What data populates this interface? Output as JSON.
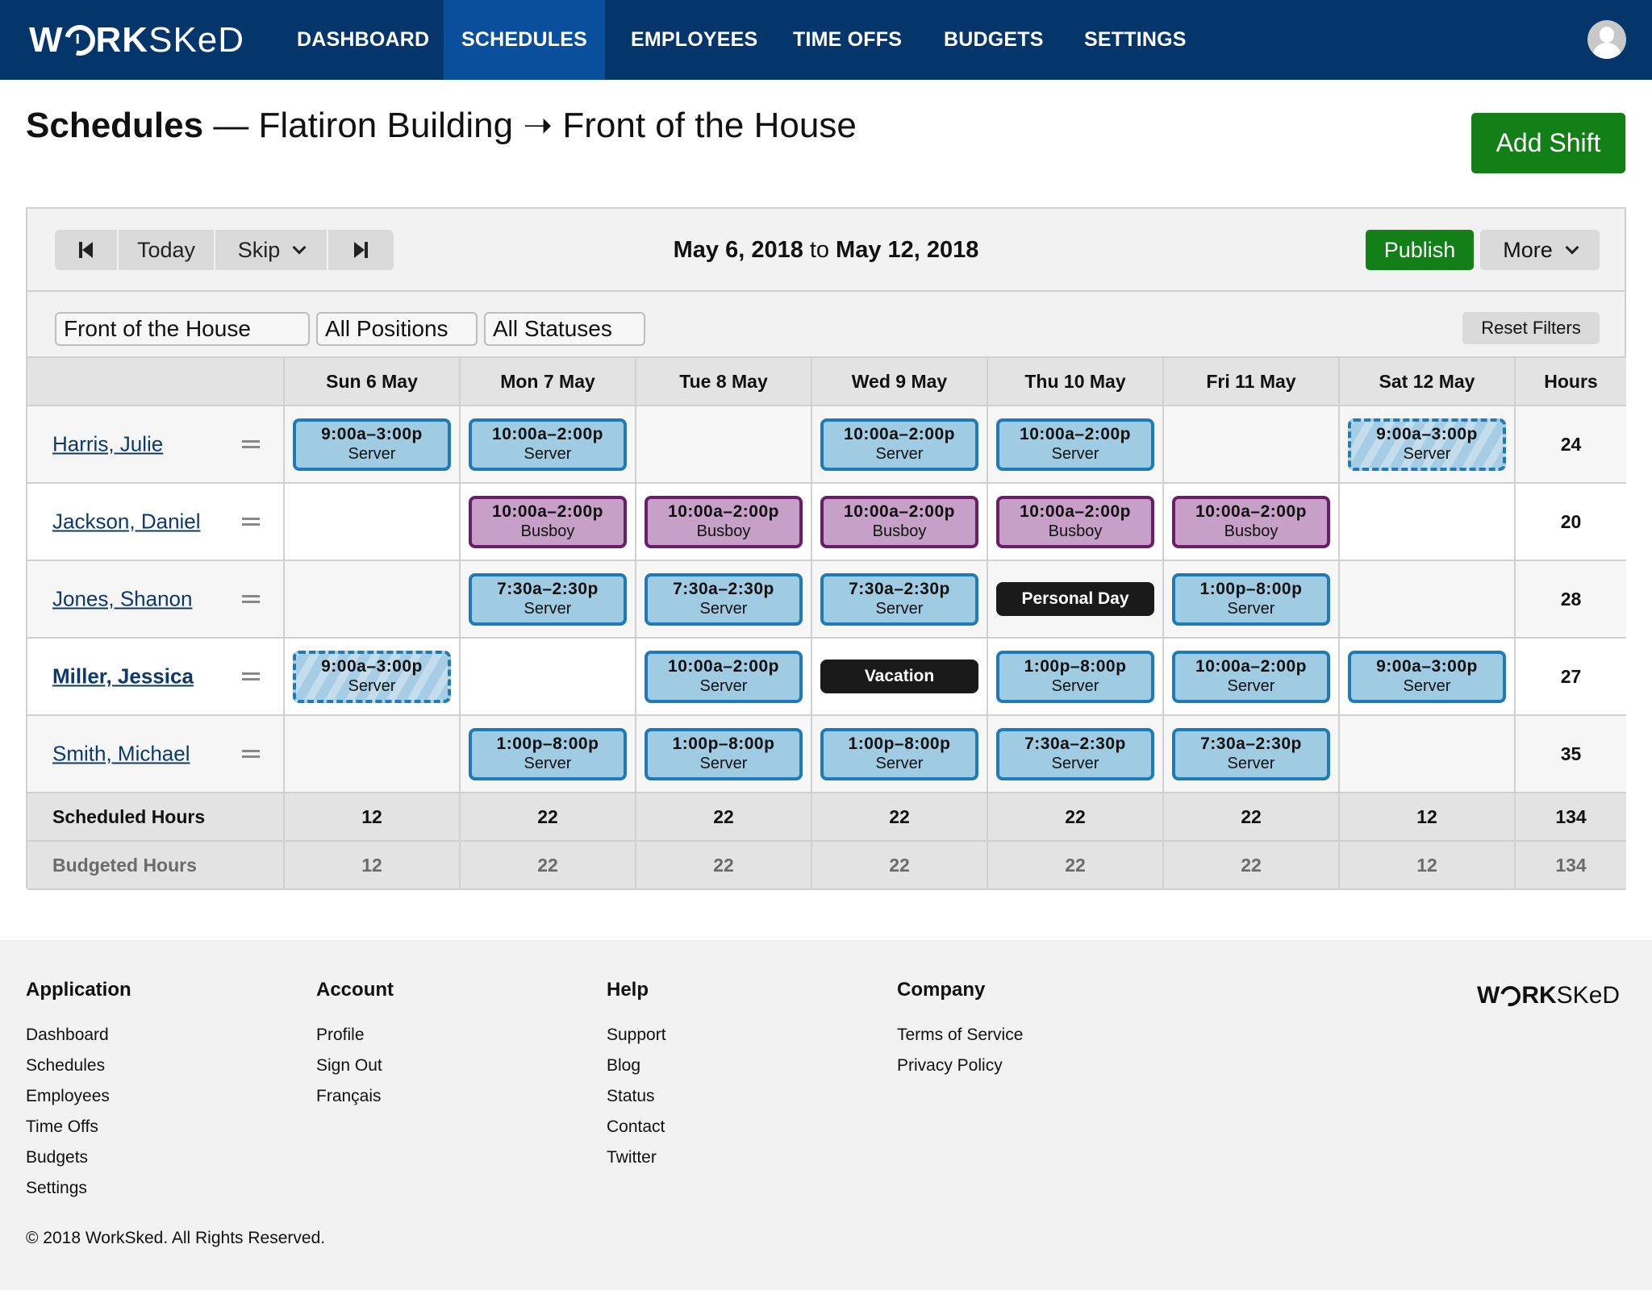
{
  "brand": {
    "logo_bold": "W",
    "logo_bold2": "RK",
    "logo_light": "SKeD",
    "name": "WorkSked"
  },
  "nav": {
    "items": [
      {
        "label": "DASHBOARD",
        "active": false
      },
      {
        "label": "SCHEDULES",
        "active": true
      },
      {
        "label": "EMPLOYEES",
        "active": false
      },
      {
        "label": "TIME OFFS",
        "active": false
      },
      {
        "label": "BUDGETS",
        "active": false
      },
      {
        "label": "SETTINGS",
        "active": false
      }
    ],
    "avatar_icon": "user-avatar-icon"
  },
  "header": {
    "title": "Schedules",
    "separator": " — ",
    "location": "Flatiron Building",
    "arrow": " ➝ ",
    "department": "Front of the House",
    "add_shift_label": "Add Shift"
  },
  "toolbar": {
    "prev_icon": "skip-previous-icon",
    "today_label": "Today",
    "skip_label": "Skip",
    "next_icon": "skip-next-icon",
    "date_start": "May 6, 2018",
    "date_to": "to",
    "date_end": "May 12, 2018",
    "publish_label": "Publish",
    "more_label": "More"
  },
  "filters": {
    "department": "Front of the House",
    "positions": "All Positions",
    "statuses": "All Statuses",
    "reset_label": "Reset Filters"
  },
  "schedule": {
    "days": [
      "Sun 6 May",
      "Mon 7 May",
      "Tue 8 May",
      "Wed 9 May",
      "Thu 10 May",
      "Fri 11 May",
      "Sat 12 May"
    ],
    "hours_header": "Hours",
    "employees": [
      {
        "name": "Harris, Julie",
        "bold": false,
        "hours": "24",
        "cells": [
          {
            "type": "shift",
            "time": "9:00a–3:00p",
            "role": "Server",
            "position": "server",
            "published": true
          },
          {
            "type": "shift",
            "time": "10:00a–2:00p",
            "role": "Server",
            "position": "server",
            "published": true
          },
          null,
          {
            "type": "shift",
            "time": "10:00a–2:00p",
            "role": "Server",
            "position": "server",
            "published": true
          },
          {
            "type": "shift",
            "time": "10:00a–2:00p",
            "role": "Server",
            "position": "server",
            "published": true
          },
          null,
          {
            "type": "shift",
            "time": "9:00a–3:00p",
            "role": "Server",
            "position": "server",
            "published": false
          }
        ]
      },
      {
        "name": "Jackson, Daniel",
        "bold": false,
        "hours": "20",
        "cells": [
          null,
          {
            "type": "shift",
            "time": "10:00a–2:00p",
            "role": "Busboy",
            "position": "busboy",
            "published": true
          },
          {
            "type": "shift",
            "time": "10:00a–2:00p",
            "role": "Busboy",
            "position": "busboy",
            "published": true
          },
          {
            "type": "shift",
            "time": "10:00a–2:00p",
            "role": "Busboy",
            "position": "busboy",
            "published": true
          },
          {
            "type": "shift",
            "time": "10:00a–2:00p",
            "role": "Busboy",
            "position": "busboy",
            "published": true
          },
          {
            "type": "shift",
            "time": "10:00a–2:00p",
            "role": "Busboy",
            "position": "busboy",
            "published": true
          },
          null
        ]
      },
      {
        "name": "Jones, Shanon",
        "bold": false,
        "hours": "28",
        "cells": [
          null,
          {
            "type": "shift",
            "time": "7:30a–2:30p",
            "role": "Server",
            "position": "server",
            "published": true
          },
          {
            "type": "shift",
            "time": "7:30a–2:30p",
            "role": "Server",
            "position": "server",
            "published": true
          },
          {
            "type": "shift",
            "time": "7:30a–2:30p",
            "role": "Server",
            "position": "server",
            "published": true
          },
          {
            "type": "timeoff",
            "label": "Personal Day"
          },
          {
            "type": "shift",
            "time": "1:00p–8:00p",
            "role": "Server",
            "position": "server",
            "published": true
          },
          null
        ]
      },
      {
        "name": "Miller, Jessica",
        "bold": true,
        "hours": "27",
        "cells": [
          {
            "type": "shift",
            "time": "9:00a–3:00p",
            "role": "Server",
            "position": "server",
            "published": false
          },
          null,
          {
            "type": "shift",
            "time": "10:00a–2:00p",
            "role": "Server",
            "position": "server",
            "published": true
          },
          {
            "type": "timeoff",
            "label": "Vacation"
          },
          {
            "type": "shift",
            "time": "1:00p–8:00p",
            "role": "Server",
            "position": "server",
            "published": true
          },
          {
            "type": "shift",
            "time": "10:00a–2:00p",
            "role": "Server",
            "position": "server",
            "published": true
          },
          {
            "type": "shift",
            "time": "9:00a–3:00p",
            "role": "Server",
            "position": "server",
            "published": true
          }
        ]
      },
      {
        "name": "Smith, Michael",
        "bold": false,
        "hours": "35",
        "cells": [
          null,
          {
            "type": "shift",
            "time": "1:00p–8:00p",
            "role": "Server",
            "position": "server",
            "published": true
          },
          {
            "type": "shift",
            "time": "1:00p–8:00p",
            "role": "Server",
            "position": "server",
            "published": true
          },
          {
            "type": "shift",
            "time": "1:00p–8:00p",
            "role": "Server",
            "position": "server",
            "published": true
          },
          {
            "type": "shift",
            "time": "7:30a–2:30p",
            "role": "Server",
            "position": "server",
            "published": true
          },
          {
            "type": "shift",
            "time": "7:30a–2:30p",
            "role": "Server",
            "position": "server",
            "published": true
          },
          null
        ]
      }
    ],
    "scheduled": {
      "label": "Scheduled Hours",
      "values": [
        "12",
        "22",
        "22",
        "22",
        "22",
        "22",
        "12"
      ],
      "total": "134"
    },
    "budgeted": {
      "label": "Budgeted Hours",
      "values": [
        "12",
        "22",
        "22",
        "22",
        "22",
        "22",
        "12"
      ],
      "total": "134"
    }
  },
  "colors": {
    "nav_bg": "#04366b",
    "nav_active": "#0a4f9c",
    "primary_green": "#137f17",
    "server_fill": "#9fcbe3",
    "server_border": "#1f7ab8",
    "busboy_fill": "#c6a0c6",
    "busboy_border": "#6b1c6b",
    "timeoff_fill": "#1a1a1a"
  },
  "footer": {
    "columns": [
      {
        "heading": "Application",
        "links": [
          "Dashboard",
          "Schedules",
          "Employees",
          "Time Offs",
          "Budgets",
          "Settings"
        ]
      },
      {
        "heading": "Account",
        "links": [
          "Profile",
          "Sign Out",
          "Français"
        ]
      },
      {
        "heading": "Help",
        "links": [
          "Support",
          "Blog",
          "Status",
          "Contact",
          "Twitter"
        ]
      },
      {
        "heading": "Company",
        "links": [
          "Terms of Service",
          "Privacy Policy"
        ]
      }
    ],
    "copyright": "© 2018 WorkSked. All Rights Reserved."
  }
}
